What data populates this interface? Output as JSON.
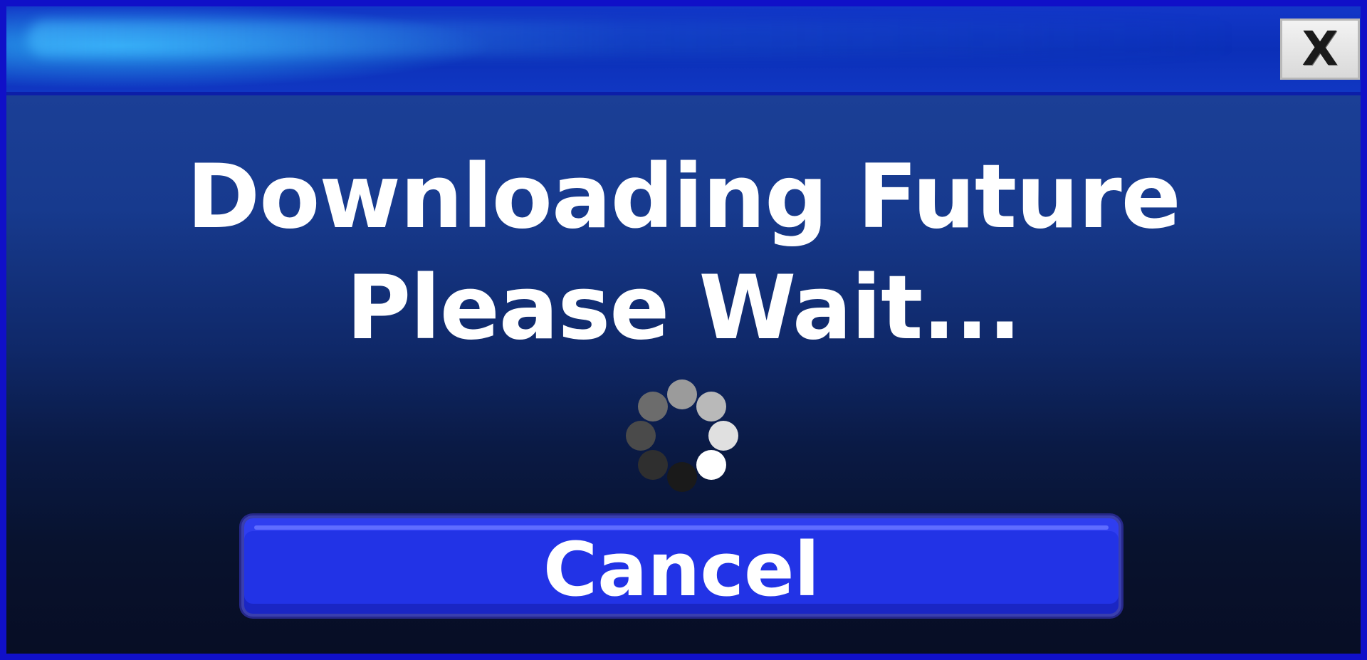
{
  "window": {
    "close_label": "X"
  },
  "message": {
    "line1": "Downloading Future",
    "line2": "Please Wait..."
  },
  "spinner": {
    "icon": "loading-spinner-icon",
    "dot_count": 8
  },
  "cancel_label": "Cancel",
  "colors": {
    "frame": "#1010c8",
    "titlebar": "#0b2fb8",
    "button": "#2233e6",
    "text": "#ffffff"
  }
}
